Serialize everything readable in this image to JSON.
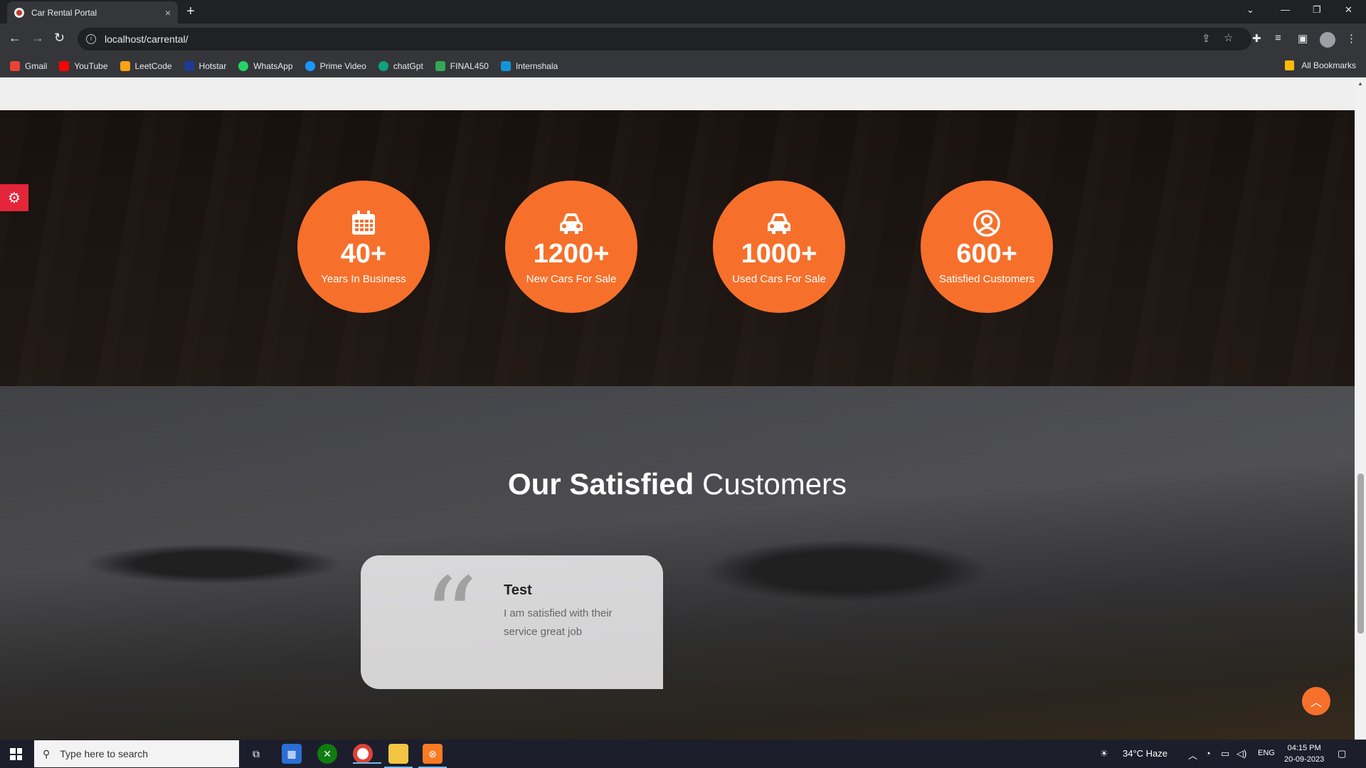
{
  "browser": {
    "tab_title": "Car Rental Portal",
    "tab_close": "×",
    "new_tab": "+",
    "url": "localhost/carrental/",
    "bookmarks": [
      {
        "label": "Gmail",
        "color": "#ea4335"
      },
      {
        "label": "YouTube",
        "color": "#ff0000"
      },
      {
        "label": "LeetCode",
        "color": "#ffa116"
      },
      {
        "label": "Hotstar",
        "color": "#1f3a93"
      },
      {
        "label": "WhatsApp",
        "color": "#25d366"
      },
      {
        "label": "Prime Video",
        "color": "#1a98ff"
      },
      {
        "label": "chatGpt",
        "color": "#10a37f"
      },
      {
        "label": "FINAL450",
        "color": "#34a853"
      },
      {
        "label": "Internshala",
        "color": "#1295d8"
      }
    ],
    "all_bookmarks": "All Bookmarks"
  },
  "stats": [
    {
      "icon": "calendar-icon",
      "value": "40+",
      "label": "Years In Business"
    },
    {
      "icon": "car-icon",
      "value": "1200+",
      "label": "New Cars For Sale"
    },
    {
      "icon": "car-icon",
      "value": "1000+",
      "label": "Used Cars For Sale"
    },
    {
      "icon": "user-circle-icon",
      "value": "600+",
      "label": "Satisfied Customers"
    }
  ],
  "testimonials": {
    "title_bold": "Our Satisfied",
    "title_light": "Customers",
    "items": [
      {
        "name": "Test",
        "message": "I am satisfied with their service great job"
      }
    ]
  },
  "taskbar": {
    "search_placeholder": "Type here to search",
    "weather": "34°C  Haze",
    "language": "ENG",
    "time": "04:15 PM",
    "date": "20-09-2023"
  },
  "colors": {
    "accent": "#f6702b",
    "settings": "#e5253a"
  }
}
